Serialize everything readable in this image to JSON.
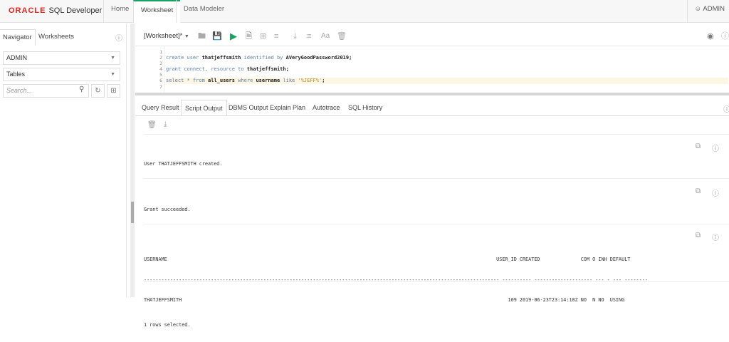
{
  "app": {
    "brand": "ORACLE",
    "product": "SQL Developer",
    "tabs": [
      "Home",
      "Worksheet",
      "Data Modeler"
    ],
    "active_tab": "Worksheet",
    "user": "ADMIN"
  },
  "navigator": {
    "tabs": [
      "Navigator",
      "Worksheets"
    ],
    "schema": "ADMIN",
    "object_type": "Tables",
    "search_placeholder": "Search..."
  },
  "worksheet": {
    "name": "[Worksheet]*",
    "line_numbers": [
      "1",
      "2",
      "3",
      "4",
      "5",
      "6",
      "7"
    ],
    "lines": [
      {
        "n": "1",
        "parts": []
      },
      {
        "n": "2",
        "parts": [
          {
            "t": "create user ",
            "c": "kw"
          },
          {
            "t": "thatjeffsmith ",
            "c": "b"
          },
          {
            "t": "identified by ",
            "c": "kw"
          },
          {
            "t": "AVeryGoodPassword2019;",
            "c": "b"
          }
        ]
      },
      {
        "n": "3",
        "parts": []
      },
      {
        "n": "4",
        "parts": [
          {
            "t": "grant connect, resource to ",
            "c": "kw"
          },
          {
            "t": "thatjeffsmith;",
            "c": "b"
          }
        ]
      },
      {
        "n": "5",
        "parts": []
      },
      {
        "n": "6",
        "parts": [
          {
            "t": "select * from ",
            "c": "kw"
          },
          {
            "t": "all_users ",
            "c": "b"
          },
          {
            "t": "where ",
            "c": "kw"
          },
          {
            "t": "username ",
            "c": "b"
          },
          {
            "t": "like ",
            "c": "kw"
          },
          {
            "t": "'%JEFF%'",
            "c": "str"
          },
          {
            "t": ";",
            "c": "b"
          }
        ]
      },
      {
        "n": "7",
        "parts": []
      }
    ]
  },
  "results": {
    "tabs": [
      "Query Result",
      "Script Output",
      "DBMS Output",
      "Explain Plan",
      "Autotrace",
      "SQL History"
    ],
    "active_tab": "Script Output",
    "messages": [
      "User THATJEFFSMITH created.",
      "Grant succeeded."
    ],
    "table": {
      "header": "USERNAME                                                                                                                 USER_ID CREATED              COM O INH DEFAULT",
      "dashes": "-------------------------------------------------------------------------------------------------------------------------- ---------- -------------------- --- - --- --------",
      "row": "THATJEFFSMITH                                                                                                                109 2019-06-23T23:14:10Z NO  N NO  USING",
      "footer": "1 rows selected."
    }
  }
}
